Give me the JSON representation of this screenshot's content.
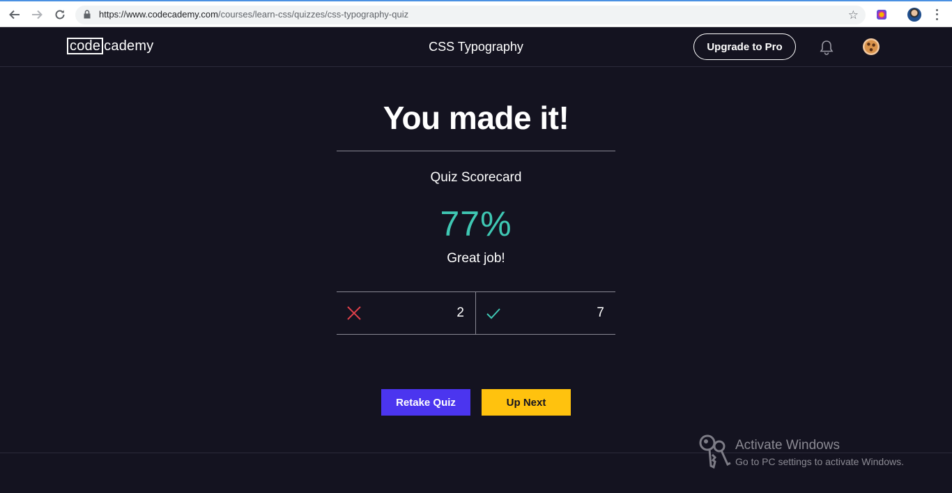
{
  "browser": {
    "url_host": "https://www.codecademy.com",
    "url_path": "/courses/learn-css/quizzes/css-typography-quiz"
  },
  "header": {
    "logo_code": "code",
    "logo_cademy": "cademy",
    "title": "CSS Typography",
    "upgrade_label": "Upgrade to Pro"
  },
  "quiz": {
    "headline": "You made it!",
    "scorecard_label": "Quiz Scorecard",
    "percent": "77%",
    "message": "Great job!",
    "incorrect_count": "2",
    "correct_count": "7"
  },
  "actions": {
    "retake_label": "Retake Quiz",
    "next_label": "Up Next"
  },
  "watermark": {
    "title": "Activate Windows",
    "subtitle": "Go to PC settings to activate Windows."
  },
  "colors": {
    "background": "#141320",
    "accent_teal": "#3fc7b3",
    "retake_purple": "#4b35ef",
    "next_yellow": "#ffc20e",
    "incorrect_red": "#e0404a"
  },
  "icons": [
    "back-arrow-icon",
    "forward-arrow-icon",
    "reload-icon",
    "lock-icon",
    "star-icon",
    "extension-icon",
    "profile-icon",
    "menu-dots-icon",
    "bell-icon",
    "avatar-icon",
    "cross-icon",
    "check-icon",
    "key-icon"
  ]
}
